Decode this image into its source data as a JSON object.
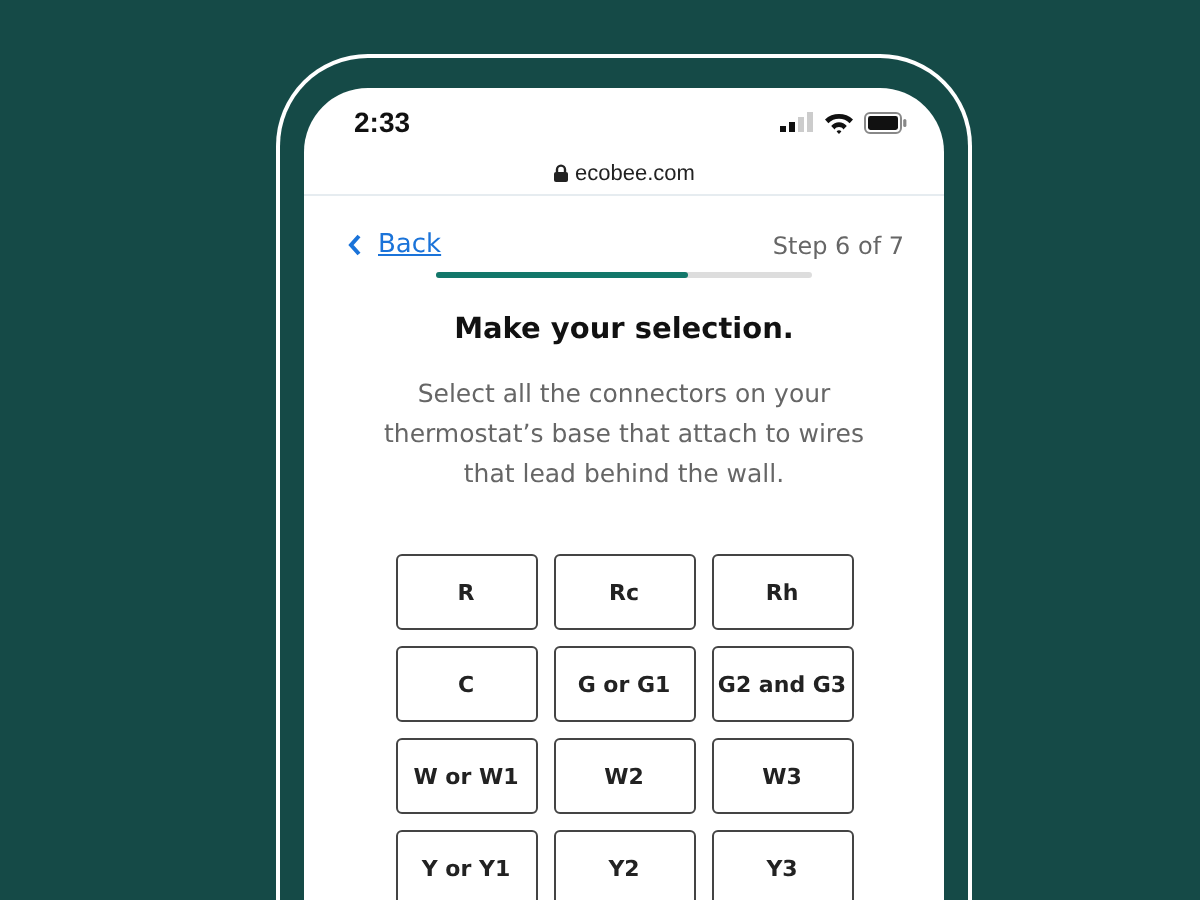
{
  "status_bar": {
    "time": "2:33"
  },
  "browser": {
    "url": "ecobee.com"
  },
  "header": {
    "back": "Back",
    "step": "Step 6 of 7",
    "progress": {
      "level": 0.67
    }
  },
  "title": "Make your selection.",
  "description": "Select all the connectors on your thermostat’s base that attach to wires that lead behind the wall.",
  "connectors": [
    {
      "label": "R",
      "selected": false
    },
    {
      "label": "Rc",
      "selected": false
    },
    {
      "label": "Rh",
      "selected": false
    },
    {
      "label": "C",
      "selected": false
    },
    {
      "label": "G or G1",
      "selected": false
    },
    {
      "label": "G2 and G3",
      "selected": false
    },
    {
      "label": "W or W1",
      "selected": false
    },
    {
      "label": "W2",
      "selected": false
    },
    {
      "label": "W3",
      "selected": false
    },
    {
      "label": "Y or Y1",
      "selected": false
    },
    {
      "label": "Y2",
      "selected": false
    },
    {
      "label": "Y3",
      "selected": false
    }
  ]
}
